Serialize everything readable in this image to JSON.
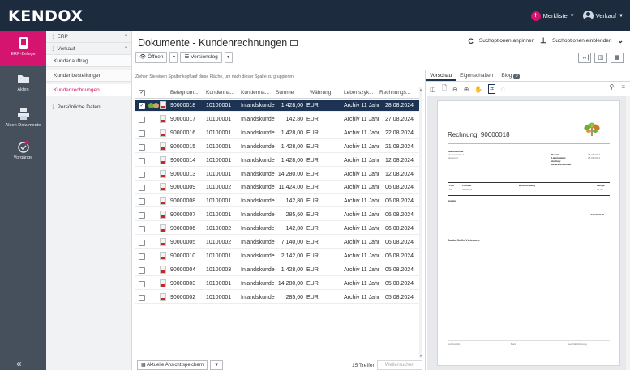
{
  "app": {
    "logo": "KENDOX",
    "watchlist_label": "Merkliste",
    "user_label": "Verkauf"
  },
  "rail": {
    "items": [
      {
        "label": "ERP-Belege",
        "icon": "tablet-icon",
        "active": true
      },
      {
        "label": "Akten",
        "icon": "folder-icon",
        "active": false
      },
      {
        "label": "Akten Dokumente",
        "icon": "printer-icon",
        "active": false
      },
      {
        "label": "Vorgänge",
        "icon": "checkmark-circle-icon",
        "active": false
      }
    ]
  },
  "tree": {
    "erp": "ERP",
    "verkauf": "Verkauf",
    "items": [
      "Kundenauftrag",
      "Kundenbestellungen",
      "Kundenrechnungen"
    ],
    "selected": "Kundenrechnungen",
    "persoenlich": "Persönliche Daten"
  },
  "main": {
    "title": "Dokumente - Kundenrechnungen",
    "search_options_toggle": "Suchoptionen anpinnen",
    "search_options_show": "Suchoptionen einblenden",
    "open_label": "Öffnen",
    "version_label": "Versionslog",
    "group_hint": "Ziehen Sie einen Spaltenkopf auf diese Fläche, um nach dieser Spalte zu gruppieren"
  },
  "grid": {
    "columns": [
      "Belegnum...",
      "Kundenna...",
      "Kundenna...",
      "Summe",
      "Währung",
      "Lebenszyk...",
      "Rechnungs..."
    ],
    "rows": [
      {
        "beleg": "90000018",
        "kunde_nr": "10100001",
        "kunde_name": "Inlandskunde",
        "summe": "1.428,00",
        "waehrung": "EUR",
        "lebenszyklus": "Archiv 11 Jahr",
        "datum": "28.08.2024",
        "selected": true
      },
      {
        "beleg": "90000017",
        "kunde_nr": "10100001",
        "kunde_name": "Inlandskunde",
        "summe": "142,80",
        "waehrung": "EUR",
        "lebenszyklus": "Archiv 11 Jahr",
        "datum": "27.08.2024",
        "selected": false
      },
      {
        "beleg": "90000016",
        "kunde_nr": "10100001",
        "kunde_name": "Inlandskunde",
        "summe": "1.428,00",
        "waehrung": "EUR",
        "lebenszyklus": "Archiv 11 Jahr",
        "datum": "22.08.2024",
        "selected": false
      },
      {
        "beleg": "90000015",
        "kunde_nr": "10100001",
        "kunde_name": "Inlandskunde",
        "summe": "1.428,00",
        "waehrung": "EUR",
        "lebenszyklus": "Archiv 11 Jahr",
        "datum": "21.08.2024",
        "selected": false
      },
      {
        "beleg": "90000014",
        "kunde_nr": "10100001",
        "kunde_name": "Inlandskunde",
        "summe": "1.428,00",
        "waehrung": "EUR",
        "lebenszyklus": "Archiv 11 Jahr",
        "datum": "12.08.2024",
        "selected": false
      },
      {
        "beleg": "90000013",
        "kunde_nr": "10100001",
        "kunde_name": "Inlandskunde",
        "summe": "14.280,00",
        "waehrung": "EUR",
        "lebenszyklus": "Archiv 11 Jahr",
        "datum": "12.08.2024",
        "selected": false
      },
      {
        "beleg": "90000009",
        "kunde_nr": "10100002",
        "kunde_name": "Inlandskunde",
        "summe": "11.424,00",
        "waehrung": "EUR",
        "lebenszyklus": "Archiv 11 Jahr",
        "datum": "06.08.2024",
        "selected": false
      },
      {
        "beleg": "90000008",
        "kunde_nr": "10100001",
        "kunde_name": "Inlandskunde",
        "summe": "142,80",
        "waehrung": "EUR",
        "lebenszyklus": "Archiv 11 Jahr",
        "datum": "06.08.2024",
        "selected": false
      },
      {
        "beleg": "90000007",
        "kunde_nr": "10100001",
        "kunde_name": "Inlandskunde",
        "summe": "285,60",
        "waehrung": "EUR",
        "lebenszyklus": "Archiv 11 Jahr",
        "datum": "06.08.2024",
        "selected": false
      },
      {
        "beleg": "90000006",
        "kunde_nr": "10100002",
        "kunde_name": "Inlandskunde",
        "summe": "142,80",
        "waehrung": "EUR",
        "lebenszyklus": "Archiv 11 Jahr",
        "datum": "06.08.2024",
        "selected": false
      },
      {
        "beleg": "90000005",
        "kunde_nr": "10100002",
        "kunde_name": "Inlandskunde",
        "summe": "7.140,00",
        "waehrung": "EUR",
        "lebenszyklus": "Archiv 11 Jahr",
        "datum": "06.08.2024",
        "selected": false
      },
      {
        "beleg": "90000010",
        "kunde_nr": "10100001",
        "kunde_name": "Inlandskunde",
        "summe": "2.142,00",
        "waehrung": "EUR",
        "lebenszyklus": "Archiv 11 Jahr",
        "datum": "06.08.2024",
        "selected": false
      },
      {
        "beleg": "90000004",
        "kunde_nr": "10100003",
        "kunde_name": "Inlandskunde",
        "summe": "1.428,00",
        "waehrung": "EUR",
        "lebenszyklus": "Archiv 11 Jahr",
        "datum": "05.08.2024",
        "selected": false
      },
      {
        "beleg": "90000003",
        "kunde_nr": "10100001",
        "kunde_name": "Inlandskunde",
        "summe": "14.280,00",
        "waehrung": "EUR",
        "lebenszyklus": "Archiv 11 Jahr",
        "datum": "05.08.2024",
        "selected": false
      },
      {
        "beleg": "90000002",
        "kunde_nr": "10100001",
        "kunde_name": "Inlandskunde",
        "summe": "285,60",
        "waehrung": "EUR",
        "lebenszyklus": "Archiv 11 Jahr",
        "datum": "05.08.2024",
        "selected": false
      }
    ]
  },
  "footer": {
    "save_view": "Aktuelle Ansicht speichern",
    "hits": "15 Treffer",
    "more": "Weitersuchen"
  },
  "preview": {
    "tabs": [
      "Vorschau",
      "Eigenschaften",
      "Blog"
    ],
    "blog_count": "0",
    "doc_title": "Rechnung: 90000018",
    "thanks": "Danke für Ihr Vertrauen."
  },
  "colors": {
    "topbar": "#1d2b3f",
    "accent": "#d4146e",
    "rail": "#46505c",
    "selected_row": "#1c3354"
  }
}
